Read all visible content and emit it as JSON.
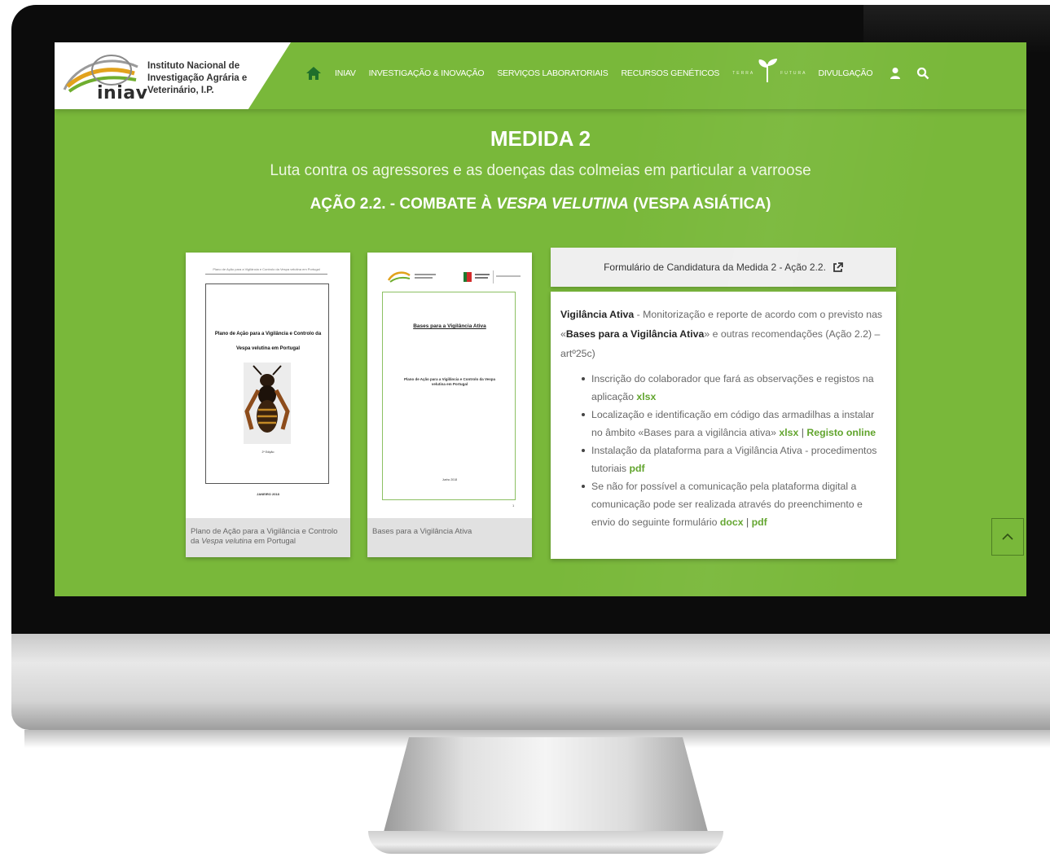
{
  "header": {
    "logo_word": "iniav",
    "institute_lines": [
      "Instituto Nacional de",
      "Investigação Agrária e",
      "Veterinário, I.P."
    ],
    "nav_items": [
      "INIAV",
      "INVESTIGAÇÃO & INOVAÇÃO",
      "SERVIÇOS LABORATORIAIS",
      "RECURSOS GENÉTICOS"
    ],
    "terra_left": "TERRA",
    "terra_right": "FUTURA",
    "nav_last": "DIVULGAÇÃO",
    "icons": [
      "home-icon",
      "user-icon",
      "search-icon"
    ]
  },
  "hero": {
    "title": "MEDIDA 2",
    "subtitle": "Luta contra os agressores e as doenças das colmeias em particular a varroose",
    "action_prefix": "AÇÃO 2.2. - COMBATE À ",
    "action_italic": "VESPA VELUTINA",
    "action_suffix": " (VESPA ASIÁTICA)"
  },
  "documents": [
    {
      "page_header": "Plano de Ação para a Vigilância e Controlo da Vespa velutina em Portugal",
      "page_title_line1": "Plano de Ação para a Vigilância e Controlo da",
      "page_title_line2": "Vespa velutina em Portugal",
      "page_note": "2ª Edição",
      "page_date": "JANEIRO 2018",
      "caption_prefix": "Plano de Ação para a Vigilância e Controlo da ",
      "caption_italic": "Vespa velutina",
      "caption_suffix": " em Portugal"
    },
    {
      "page_title": "Bases para a Vigilância Ativa",
      "page_sub": "Plano de Ação para a Vigilância e Controlo da Vespa velutina em Portugal",
      "page_date": "Junho 2018",
      "page_number": "1",
      "caption": "Bases para a Vigilância Ativa"
    }
  ],
  "form_button": {
    "label": "Formulário de Candidatura da Medida 2 - Ação 2.2.",
    "icon": "external-link-icon"
  },
  "info": {
    "lead_bold": "Vigilância Ativa",
    "lead_text1": " - Monitorização e reporte de acordo com o previsto nas «",
    "lead_bold2": "Bases para a Vigilância Ativa",
    "lead_text2": "» e outras recomendações (Ação 2.2) – artº25c)",
    "items": [
      {
        "text": "Inscrição do colaborador que fará as observações e registos na aplicação ",
        "link1": "xlsx"
      },
      {
        "text": "Localização e identificação em código das armadilhas a instalar no âmbito «Bases para a vigilância ativa» ",
        "link1": "xlsx",
        "sep": " | ",
        "link2": "Registo online"
      },
      {
        "text": "Instalação da plataforma para a Vigilância Ativa - procedimentos tutoriais ",
        "link1": "pdf"
      },
      {
        "text": "Se não for possível a comunicação pela plataforma digital a comunicação pode ser realizada através do preenchimento e envio do seguinte formulário ",
        "link1": "docx",
        "sep": " | ",
        "link2": "pdf"
      }
    ]
  },
  "colors": {
    "brand_green": "#79b83a",
    "link_green": "#5fa32a"
  },
  "scroll_top_icon": "chevron-up-icon"
}
